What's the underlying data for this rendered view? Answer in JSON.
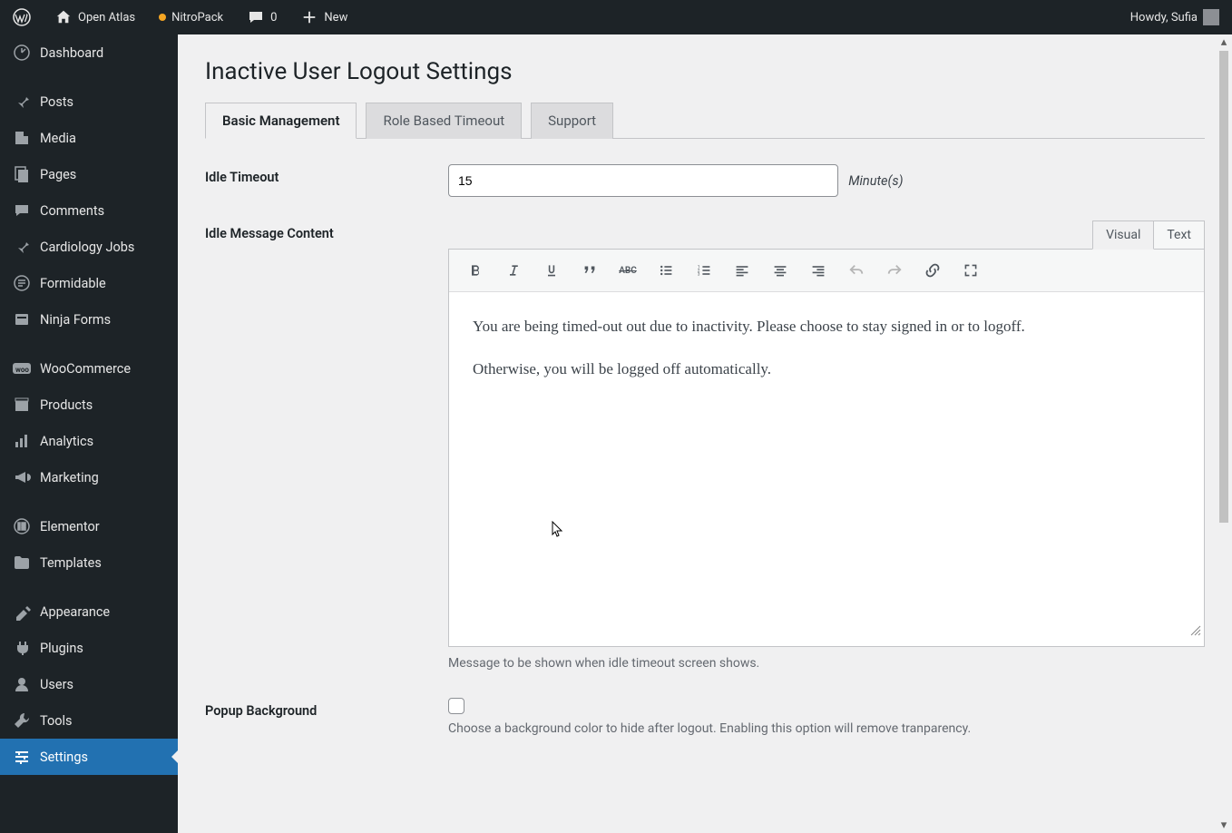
{
  "adminbar": {
    "site_name": "Open Atlas",
    "nitro": "NitroPack",
    "comments_count": "0",
    "new_label": "New",
    "howdy": "Howdy, Sufia"
  },
  "sidebar": {
    "items": [
      {
        "icon": "dashboard",
        "label": "Dashboard"
      },
      {
        "sep": true
      },
      {
        "icon": "pin",
        "label": "Posts"
      },
      {
        "icon": "media",
        "label": "Media"
      },
      {
        "icon": "pages",
        "label": "Pages"
      },
      {
        "icon": "comments",
        "label": "Comments"
      },
      {
        "icon": "pin",
        "label": "Cardiology Jobs"
      },
      {
        "icon": "formidable",
        "label": "Formidable"
      },
      {
        "icon": "ninja",
        "label": "Ninja Forms"
      },
      {
        "sep": true
      },
      {
        "icon": "woo",
        "label": "WooCommerce"
      },
      {
        "icon": "products",
        "label": "Products"
      },
      {
        "icon": "analytics",
        "label": "Analytics"
      },
      {
        "icon": "marketing",
        "label": "Marketing"
      },
      {
        "sep": true
      },
      {
        "icon": "elementor",
        "label": "Elementor"
      },
      {
        "icon": "templates",
        "label": "Templates"
      },
      {
        "sep": true
      },
      {
        "icon": "appearance",
        "label": "Appearance"
      },
      {
        "icon": "plugins",
        "label": "Plugins"
      },
      {
        "icon": "users",
        "label": "Users"
      },
      {
        "icon": "tools",
        "label": "Tools"
      },
      {
        "icon": "settings",
        "label": "Settings",
        "current": true
      }
    ]
  },
  "page": {
    "title": "Inactive User Logout Settings",
    "tabs": {
      "basic": "Basic Management",
      "role": "Role Based Timeout",
      "support": "Support"
    },
    "idle_timeout_label": "Idle Timeout",
    "idle_timeout_value": "15",
    "idle_timeout_unit": "Minute(s)",
    "idle_message_label": "Idle Message Content",
    "editor_tabs": {
      "visual": "Visual",
      "text": "Text"
    },
    "message_p1": "You are being timed-out out due to inactivity. Please choose to stay signed in or to logoff.",
    "message_p2": "Otherwise, you will be logged off automatically.",
    "message_help": "Message to be shown when idle timeout screen shows.",
    "popup_bg_label": "Popup Background",
    "popup_bg_help": "Choose a background color to hide after logout. Enabling this option will remove tranparency."
  }
}
